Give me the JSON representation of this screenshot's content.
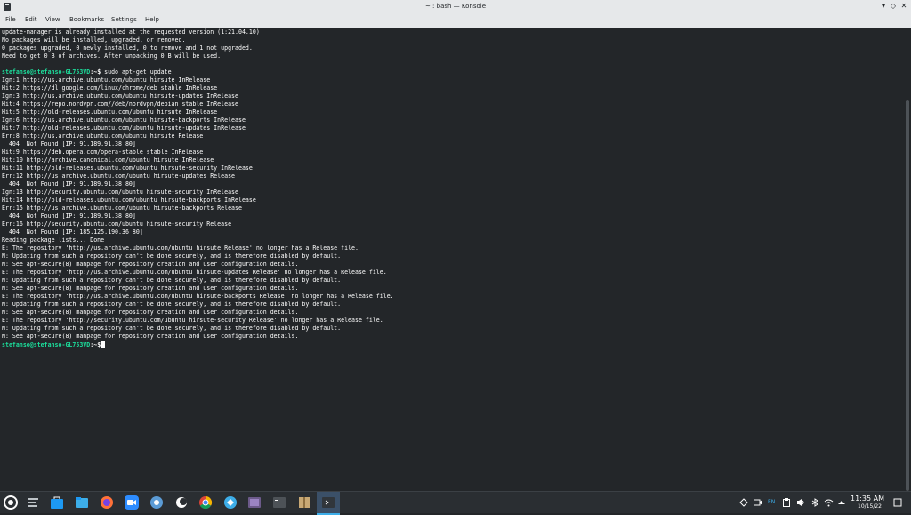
{
  "window": {
    "title": "~ : bash — Konsole",
    "controls": [
      "▾",
      "◇",
      "✕"
    ]
  },
  "menu": [
    "File",
    "Edit",
    "View",
    "Bookmarks",
    "Settings",
    "Help"
  ],
  "terminal": {
    "lines": [
      "update-manager is already installed at the requested version (1:21.04.10)",
      "No packages will be installed, upgraded, or removed.",
      "0 packages upgraded, 0 newly installed, 0 to remove and 1 not upgraded.",
      "Need to get 0 B of archives. After unpacking 0 B will be used.",
      "",
      "",
      "Ign:1 http://us.archive.ubuntu.com/ubuntu hirsute InRelease",
      "Hit:2 https://dl.google.com/linux/chrome/deb stable InRelease",
      "Ign:3 http://us.archive.ubuntu.com/ubuntu hirsute-updates InRelease",
      "Hit:4 https://repo.nordvpn.com//deb/nordvpn/debian stable InRelease",
      "Hit:5 http://old-releases.ubuntu.com/ubuntu hirsute InRelease",
      "Ign:6 http://us.archive.ubuntu.com/ubuntu hirsute-backports InRelease",
      "Hit:7 http://old-releases.ubuntu.com/ubuntu hirsute-updates InRelease",
      "Err:8 http://us.archive.ubuntu.com/ubuntu hirsute Release",
      "  404  Not Found [IP: 91.189.91.38 80]",
      "Hit:9 https://deb.opera.com/opera-stable stable InRelease",
      "Hit:10 http://archive.canonical.com/ubuntu hirsute InRelease",
      "Hit:11 http://old-releases.ubuntu.com/ubuntu hirsute-security InRelease",
      "Err:12 http://us.archive.ubuntu.com/ubuntu hirsute-updates Release",
      "  404  Not Found [IP: 91.189.91.38 80]",
      "Ign:13 http://security.ubuntu.com/ubuntu hirsute-security InRelease",
      "Hit:14 http://old-releases.ubuntu.com/ubuntu hirsute-backports InRelease",
      "Err:15 http://us.archive.ubuntu.com/ubuntu hirsute-backports Release",
      "  404  Not Found [IP: 91.189.91.38 80]",
      "Err:16 http://security.ubuntu.com/ubuntu hirsute-security Release",
      "  404  Not Found [IP: 185.125.190.36 80]",
      "Reading package lists... Done",
      "E: The repository 'http://us.archive.ubuntu.com/ubuntu hirsute Release' no longer has a Release file.",
      "N: Updating from such a repository can't be done securely, and is therefore disabled by default.",
      "N: See apt-secure(8) manpage for repository creation and user configuration details.",
      "E: The repository 'http://us.archive.ubuntu.com/ubuntu hirsute-updates Release' no longer has a Release file.",
      "N: Updating from such a repository can't be done securely, and is therefore disabled by default.",
      "N: See apt-secure(8) manpage for repository creation and user configuration details.",
      "E: The repository 'http://us.archive.ubuntu.com/ubuntu hirsute-backports Release' no longer has a Release file.",
      "N: Updating from such a repository can't be done securely, and is therefore disabled by default.",
      "N: See apt-secure(8) manpage for repository creation and user configuration details.",
      "E: The repository 'http://security.ubuntu.com/ubuntu hirsute-security Release' no longer has a Release file.",
      "N: Updating from such a repository can't be done securely, and is therefore disabled by default.",
      "N: See apt-secure(8) manpage for repository creation and user configuration details."
    ],
    "prompt_user": "stefanso@stefanso-GL753VD",
    "prompt_path": ":~$",
    "command": " sudo apt-get update",
    "prompt_color": "#1cdc9a",
    "text_color": "#fcfcfc",
    "background_color": "#232629"
  },
  "taskbar": {
    "icons": [
      "app-launcher-icon",
      "task-manager-icon",
      "store-icon",
      "files-icon",
      "firefox-icon",
      "zoom-icon",
      "chromium-icon",
      "thunderbird-icon",
      "chrome-icon",
      "kde-connect-icon",
      "screenshot-icon",
      "terminal-icon",
      "archive-icon",
      "konsole-icon"
    ],
    "tray_icons": [
      "discover-icon",
      "camera-icon",
      "keyboard-layout-icon",
      "clipboard-icon",
      "battery-icon",
      "volume-icon",
      "bluetooth-icon",
      "network-icon",
      "tray-expand-icon"
    ],
    "keyboard_layout": "EN",
    "clock_time": "11:35 AM",
    "clock_date": "10/15/22"
  }
}
